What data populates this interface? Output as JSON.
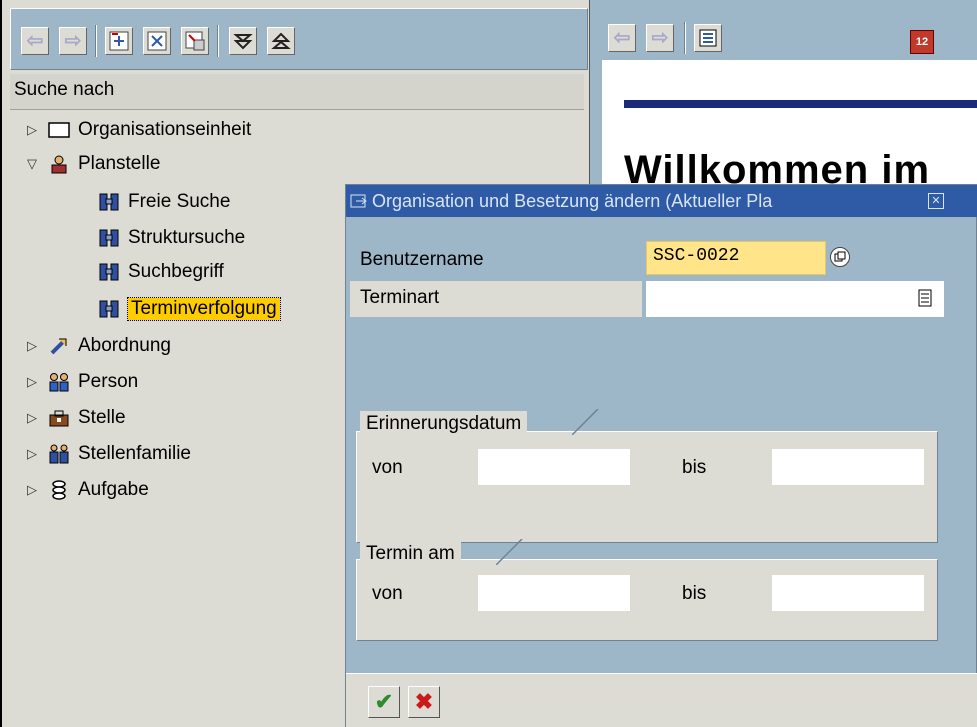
{
  "left": {
    "search_header": "Suche nach",
    "tree": [
      {
        "label": "Organisationseinheit"
      },
      {
        "label": "Planstelle"
      },
      {
        "label": "Freie Suche"
      },
      {
        "label": "Struktursuche"
      },
      {
        "label": "Suchbegriff"
      },
      {
        "label": "Terminverfolgung"
      },
      {
        "label": "Abordnung"
      },
      {
        "label": "Person"
      },
      {
        "label": "Stelle"
      },
      {
        "label": "Stellenfamilie"
      },
      {
        "label": "Aufgabe"
      }
    ]
  },
  "right": {
    "welcome_text": "Willkommen im",
    "calendar_number": "12"
  },
  "dialog": {
    "title": "Organisation und Besetzung ändern (Aktueller Pla",
    "benutzername_label": "Benutzername",
    "benutzername_value": "SSC-0022",
    "terminart_label": "Terminart",
    "terminart_value": "",
    "erinnerung": {
      "title": "Erinnerungsdatum",
      "von": "von",
      "bis": "bis"
    },
    "termin": {
      "title": "Termin am",
      "von": "von",
      "bis": "bis"
    }
  },
  "colors": {
    "accent": "#2f5ba6",
    "selection": "#ffcc00",
    "background": "#9db7c9"
  }
}
